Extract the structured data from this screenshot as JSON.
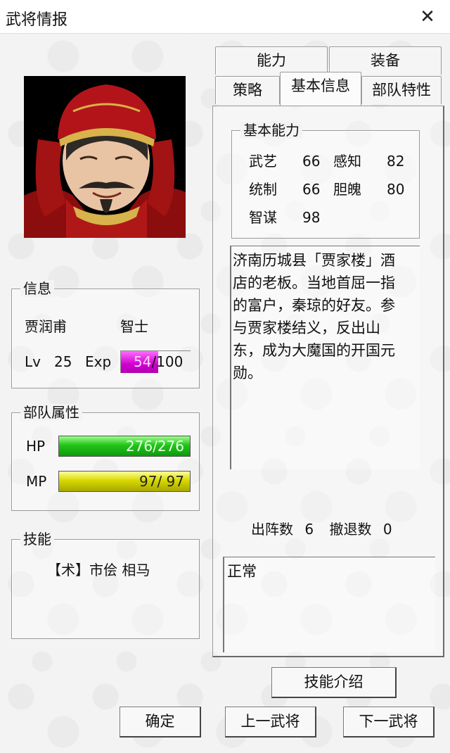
{
  "window": {
    "title": "武将情报",
    "close_glyph": "✕"
  },
  "portrait": {
    "alt": "贾润甫"
  },
  "info": {
    "legend": "信息",
    "name": "贾润甫",
    "role": "智士",
    "lv_label": "Lv",
    "lv_value": "25",
    "exp_label": "Exp",
    "exp_current": "54",
    "exp_max": "/100",
    "exp_fraction": 0.54
  },
  "troop": {
    "legend": "部队属性",
    "hp_label": "HP",
    "hp_text": "276/276",
    "hp_fraction": 1.0,
    "mp_label": "MP",
    "mp_text": "97/ 97",
    "mp_fraction": 1.0
  },
  "skill": {
    "legend": "技能",
    "entry": "【术】市侩 相马"
  },
  "tabs": {
    "row_back": [
      "能力",
      "装备"
    ],
    "row_front": [
      "策略",
      "基本信息",
      "部队特性"
    ],
    "active": "基本信息"
  },
  "basic": {
    "legend": "基本能力",
    "stats": [
      {
        "label": "武艺",
        "value": "66"
      },
      {
        "label": "感知",
        "value": "82"
      },
      {
        "label": "统制",
        "value": "66"
      },
      {
        "label": "胆魄",
        "value": "80"
      },
      {
        "label": "智谋",
        "value": "98"
      }
    ]
  },
  "bio": "济南历城县「贾家楼」酒\n店的老板。当地首屈一指\n的富户，秦琼的好友。参\n与贾家楼结义，反出山\n东，成为大魔国的开国元\n勋。",
  "sortie": {
    "deploy_label": "出阵数",
    "deploy_value": "6",
    "retreat_label": "撤退数",
    "retreat_value": "0"
  },
  "status": "正常",
  "buttons": {
    "skill_intro": "技能介绍",
    "ok": "确定",
    "prev": "上一武将",
    "next": "下一武将"
  },
  "colors": {
    "exp_bar": "#d000d0",
    "hp_bar": "#22c41a",
    "mp_bar": "#d8d800"
  }
}
